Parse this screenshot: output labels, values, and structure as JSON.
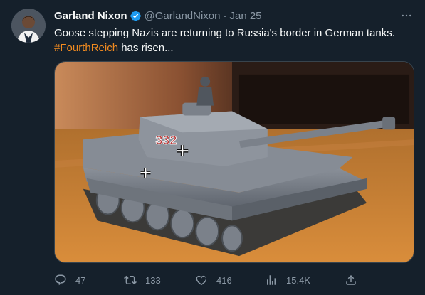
{
  "author": {
    "name": "Garland Nixon",
    "handle": "@GarlandNixon",
    "separator": "·",
    "timestamp": "Jan 25",
    "verified": true
  },
  "tweet": {
    "text_main": "Goose stepping Nazis are returning to Russia's border in German tanks.",
    "hashtag": "#FourthReich",
    "text_tail": " has risen..."
  },
  "media": {
    "turret_number": "332"
  },
  "actions": {
    "replies": "47",
    "retweets": "133",
    "likes": "416",
    "views": "15.4K"
  },
  "colors": {
    "background": "#15202b",
    "text": "#f7f9f9",
    "secondary": "#8b98a5",
    "hashtag": "#f28b20",
    "verified": "#1d9bf0"
  },
  "icons": [
    "more-icon",
    "verified-icon",
    "reply-icon",
    "retweet-icon",
    "like-icon",
    "views-icon",
    "share-icon"
  ]
}
